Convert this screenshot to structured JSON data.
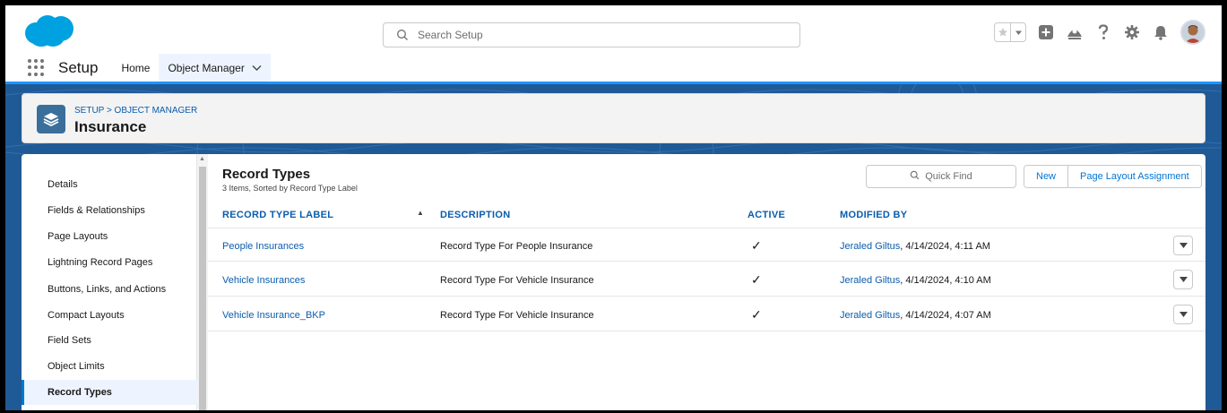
{
  "search": {
    "placeholder": "Search Setup"
  },
  "nav": {
    "app_name": "Setup",
    "tabs": [
      {
        "label": "Home"
      },
      {
        "label": "Object Manager"
      }
    ]
  },
  "page_header": {
    "breadcrumb": "SETUP > OBJECT MANAGER",
    "title": "Insurance"
  },
  "sidebar": {
    "items": [
      {
        "label": "Details"
      },
      {
        "label": "Fields & Relationships"
      },
      {
        "label": "Page Layouts"
      },
      {
        "label": "Lightning Record Pages"
      },
      {
        "label": "Buttons, Links, and Actions"
      },
      {
        "label": "Compact Layouts"
      },
      {
        "label": "Field Sets"
      },
      {
        "label": "Object Limits"
      },
      {
        "label": "Record Types"
      }
    ]
  },
  "main": {
    "title": "Record Types",
    "subtitle": "3 Items, Sorted by Record Type Label",
    "quick_find_placeholder": "Quick Find",
    "new_label": "New",
    "assignment_label": "Page Layout Assignment",
    "columns": {
      "label": "RECORD TYPE LABEL",
      "description": "DESCRIPTION",
      "active": "ACTIVE",
      "modified_by": "MODIFIED BY"
    },
    "rows": [
      {
        "label": "People Insurances",
        "description": "Record Type For People Insurance",
        "active": "✓",
        "user": "Jeraled Giltus",
        "date": ", 4/14/2024, 4:11 AM"
      },
      {
        "label": "Vehicle Insurances",
        "description": "Record Type For Vehicle Insurance",
        "active": "✓",
        "user": "Jeraled Giltus",
        "date": ", 4/14/2024, 4:10 AM"
      },
      {
        "label": "Vehicle Insurance_BKP",
        "description": "Record Type For Vehicle Insurance",
        "active": "✓",
        "user": "Jeraled Giltus",
        "date": ", 4/14/2024, 4:07 AM"
      }
    ]
  },
  "colors": {
    "brand": "#00a1e0",
    "link": "#0b5cab",
    "background": "#1f5a96",
    "accent": "#1b96ff"
  }
}
